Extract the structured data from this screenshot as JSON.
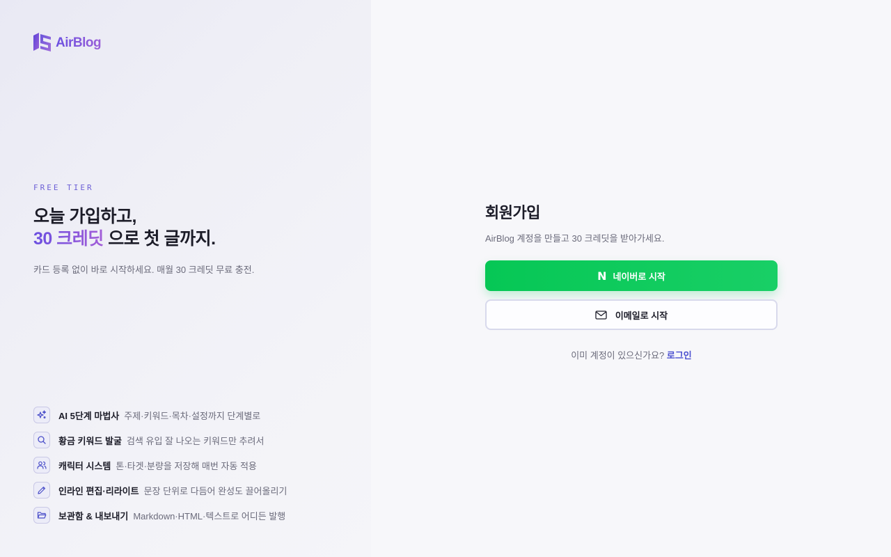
{
  "brand": {
    "name": "AirBlog"
  },
  "hero": {
    "eyebrow": "FREE TIER",
    "headline_line1": "오늘 가입하고,",
    "headline_accent": "30 크레딧",
    "headline_line2_rest": " 으로 첫 글까지.",
    "subline": "카드 등록 없이 바로 시작하세요. 매월 30 크레딧 무료 충전."
  },
  "features": [
    {
      "icon": "sparkles-icon",
      "title": "AI 5단계 마법사",
      "desc": "주제·키워드·목차·설정까지 단계별로"
    },
    {
      "icon": "search-icon",
      "title": "황금 키워드 발굴",
      "desc": "검색 유입 잘 나오는 키워드만 추려서"
    },
    {
      "icon": "users-icon",
      "title": "캐릭터 시스템",
      "desc": "톤·타겟·분량을 저장해 매번 자동 적용"
    },
    {
      "icon": "pencil-icon",
      "title": "인라인 편집·리라이트",
      "desc": "문장 단위로 다듬어 완성도 끌어올리기"
    },
    {
      "icon": "folder-icon",
      "title": "보관함 & 내보내기",
      "desc": "Markdown·HTML·텍스트로 어디든 발행"
    }
  ],
  "signup": {
    "title": "회원가입",
    "subtitle": "AirBlog 계정을 만들고 30 크레딧을 받아가세요.",
    "naver_label": "네이버로 시작",
    "naver_glyph": "N",
    "email_label": "이메일로 시작",
    "login_prompt": "이미 계정이 있으신가요?",
    "login_link": "로그인"
  },
  "colors": {
    "accent": "#6b4fe0",
    "naver_green": "#06c755",
    "link": "#4a4fd0"
  }
}
